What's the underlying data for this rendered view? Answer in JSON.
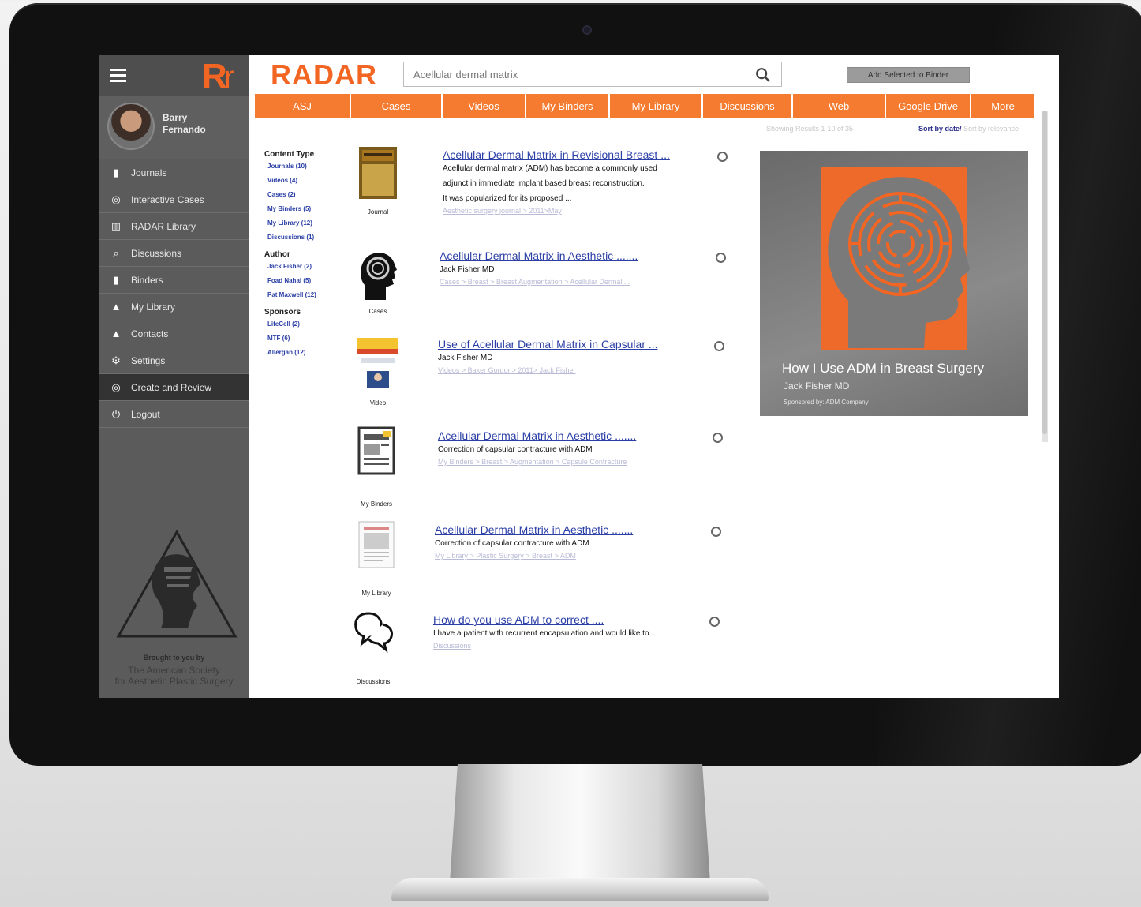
{
  "sidebar": {
    "logo": "R",
    "logo_small": "r",
    "user_name": "Barry Fernando",
    "items": [
      {
        "label": "Journals",
        "icon": "journal-icon"
      },
      {
        "label": "Interactive Cases",
        "icon": "case-icon"
      },
      {
        "label": "RADAR Library",
        "icon": "library-icon"
      },
      {
        "label": "Discussions",
        "icon": "discussion-icon"
      },
      {
        "label": "Binders",
        "icon": "binder-icon"
      },
      {
        "label": "My Library",
        "icon": "user-icon"
      },
      {
        "label": "Contacts",
        "icon": "contacts-icon"
      },
      {
        "label": "Settings",
        "icon": "gear-icon"
      },
      {
        "label": "Create and Review",
        "icon": "review-icon",
        "active": true
      },
      {
        "label": "Logout",
        "icon": "power-icon"
      }
    ],
    "brought_by": "Brought to you by",
    "society_line1": "The American Society",
    "society_line2": "for Aesthetic Plastic Surgery"
  },
  "header": {
    "brand": "RADAR",
    "search_value": "Acellular dermal matrix",
    "add_button": "Add Selected to Binder"
  },
  "tabs": [
    "ASJ",
    "Cases",
    "Videos",
    "My Binders",
    "My Library",
    "Discussions",
    "Web",
    "Google Drive",
    "More"
  ],
  "results_meta": {
    "showing": "Showing Results 1-10 of 35",
    "sort_date": "Sort by date/",
    "sort_relevance": "Sort by relevance"
  },
  "filters": [
    {
      "heading": "Content Type",
      "items": [
        "Journals (10)",
        "Videos (4)",
        "Cases (2)",
        "My Binders (5)",
        "My Library (12)",
        "Discussions (1)"
      ]
    },
    {
      "heading": "Author",
      "items": [
        "Jack Fisher (2)",
        "Foad Nahai (5)",
        "Pat Maxwell (12)"
      ]
    },
    {
      "heading": "Sponsors",
      "items": [
        "LifeCell (2)",
        "MTF (6)",
        "Allergan (12)"
      ]
    }
  ],
  "results": [
    {
      "type": "Journal",
      "title": "Acellular Dermal Matrix in Revisional Breast ...",
      "lines": [
        "Acellular dermal matrix (ADM) has become a commonly used",
        "adjunct in immediate implant based breast reconstruction.",
        "It was popularized for its proposed ..."
      ],
      "crumb": "Aesthetic surgery journal > 2011>May"
    },
    {
      "type": "Cases",
      "title": "Acellular Dermal Matrix in Aesthetic .......",
      "lines": [
        "Jack Fisher MD"
      ],
      "crumb": "Cases > Breast > Breast Augmentation > Acellular Dermal ..."
    },
    {
      "type": "Video",
      "title": "Use of Acellular Dermal Matrix in Capsular ...",
      "lines": [
        "Jack Fisher MD"
      ],
      "crumb": "Videos > Baker Gordon> 2011> Jack Fisher"
    },
    {
      "type": "My Binders",
      "title": "Acellular Dermal Matrix in Aesthetic .......",
      "lines": [
        "Correction of capsular contracture with ADM"
      ],
      "crumb": "My Binders > Breast > Augmentation > Capsule Contracture"
    },
    {
      "type": "My Library",
      "title": "Acellular Dermal Matrix in Aesthetic .......",
      "lines": [
        "Correction of capsular contracture with ADM"
      ],
      "crumb": "My Library > Plastic Surgery > Breast > ADM"
    },
    {
      "type": "Discussions",
      "title": "How do you use ADM to correct ....",
      "lines": [
        "I have a patient with recurrent encapsulation and would like to ..."
      ],
      "crumb": "Discussions"
    }
  ],
  "ad": {
    "title": "How I Use ADM in Breast Surgery",
    "author": "Jack Fisher MD",
    "sponsor": "Sponsored by: ADM Company"
  },
  "colors": {
    "accent": "#f26522",
    "tab": "#f47b30",
    "sidebar": "#5b5b5b",
    "link": "#2b3fa6"
  }
}
